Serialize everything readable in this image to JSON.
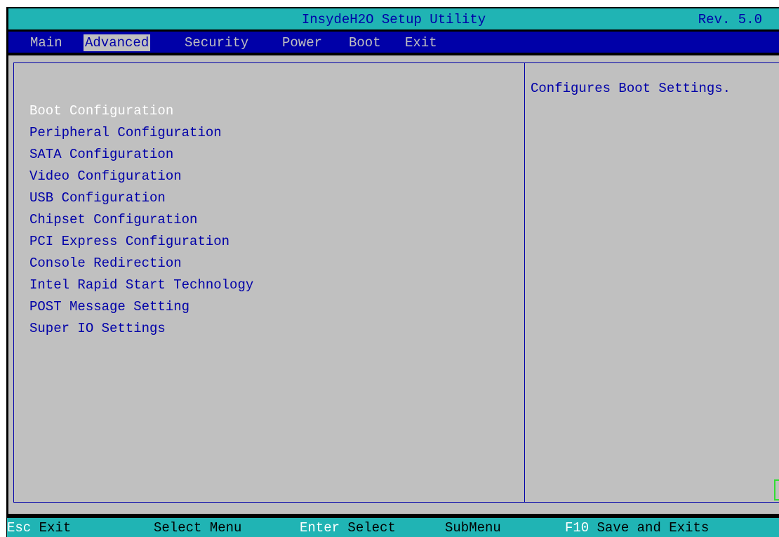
{
  "window": {
    "title": "InsydeH2O Setup Utility",
    "revision": "Rev. 5.0"
  },
  "menu": {
    "tabs": [
      {
        "label": "Main"
      },
      {
        "label": "Advanced",
        "active": true
      },
      {
        "label": "Security"
      },
      {
        "label": "Power"
      },
      {
        "label": "Boot"
      },
      {
        "label": "Exit"
      }
    ]
  },
  "options": [
    {
      "label": "Boot Configuration",
      "selected": true
    },
    {
      "label": "Peripheral Configuration"
    },
    {
      "label": "SATA Configuration"
    },
    {
      "label": "Video Configuration"
    },
    {
      "label": "USB Configuration"
    },
    {
      "label": "Chipset Configuration"
    },
    {
      "label": "PCI Express Configuration"
    },
    {
      "label": "Console Redirection"
    },
    {
      "label": "Intel Rapid Start Technology"
    },
    {
      "label": "POST Message Setting"
    },
    {
      "label": "Super IO Settings"
    }
  ],
  "help": {
    "text": "Configures Boot Settings."
  },
  "footer": {
    "esc_key": "Esc",
    "esc_desc": "Exit",
    "select_menu": "Select Menu",
    "enter_key": "Enter",
    "enter_desc": "Select",
    "submenu": "SubMenu",
    "f10_key": "F10",
    "f10_desc": "Save and Exits"
  },
  "colors": {
    "menu_bar": "#0000a8",
    "title_bar": "#20b4b4",
    "panel": "#c0c0c0",
    "text": "#0000a8",
    "selected_text": "#ffffff",
    "key_text": "#ffffff"
  }
}
